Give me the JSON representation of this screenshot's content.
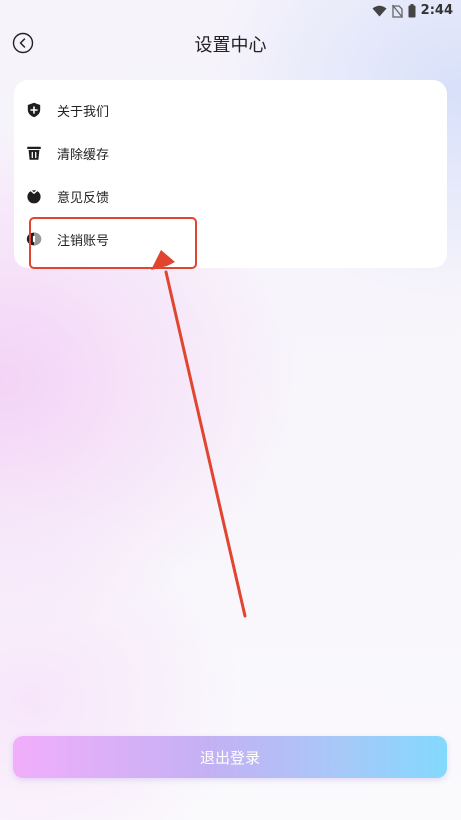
{
  "status_bar": {
    "time": "2:44",
    "icons": [
      "wifi-icon",
      "no-sim-icon",
      "battery-icon"
    ]
  },
  "header": {
    "back_icon": "back-arrow-icon",
    "title": "设置中心"
  },
  "menu": {
    "items": [
      {
        "label": "关于我们",
        "icon": "shield-plus-icon"
      },
      {
        "label": "清除缓存",
        "icon": "trash-icon"
      },
      {
        "label": "意见反馈",
        "icon": "feedback-icon"
      },
      {
        "label": "注销账号",
        "icon": "logout-eye-icon"
      }
    ]
  },
  "logout": {
    "label": "退出登录"
  },
  "colors": {
    "annotation": "#e1452f",
    "logout_gradient_start": "#f1aefb",
    "logout_gradient_end": "#83d9fd"
  }
}
